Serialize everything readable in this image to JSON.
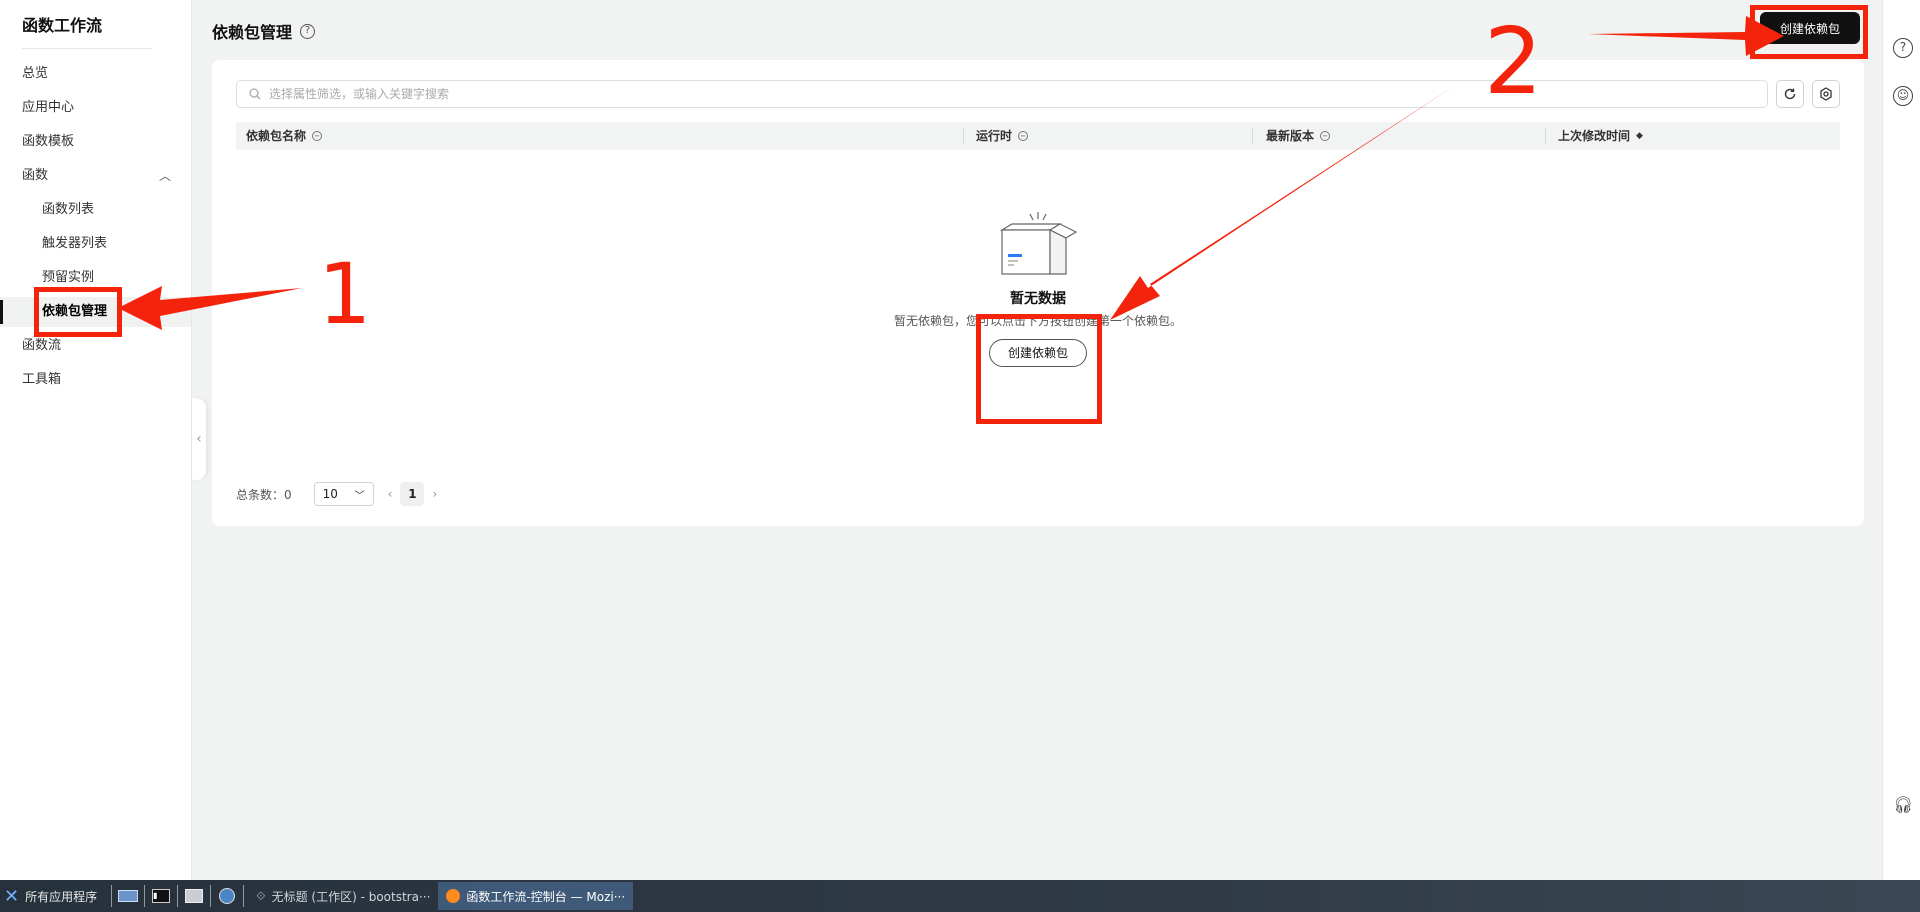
{
  "sidebar": {
    "title": "函数工作流",
    "items": [
      {
        "label": "总览"
      },
      {
        "label": "应用中心"
      },
      {
        "label": "函数模板"
      },
      {
        "label": "函数"
      },
      {
        "label": "函数列表"
      },
      {
        "label": "触发器列表"
      },
      {
        "label": "预留实例"
      },
      {
        "label": "依赖包管理"
      },
      {
        "label": "函数流"
      },
      {
        "label": "工具箱"
      }
    ]
  },
  "header": {
    "title": "依赖包管理",
    "create_label": "创建依赖包"
  },
  "search": {
    "placeholder": "选择属性筛选，或输入关键字搜索"
  },
  "table": {
    "columns": [
      "依赖包名称",
      "运行时",
      "最新版本",
      "上次修改时间"
    ]
  },
  "empty": {
    "title": "暂无数据",
    "desc": "暂无依赖包，您可以点击下方按钮创建第一个依赖包。",
    "button": "创建依赖包"
  },
  "pager": {
    "total_label": "总条数：0",
    "page_size": "10",
    "current_page": "1"
  },
  "annotations": {
    "num1": "1",
    "num2": "2",
    "color": "#f4230c"
  },
  "taskbar": {
    "start_label": "所有应用程序",
    "tasks": [
      {
        "label": "无标题 (工作区) - bootstra···"
      },
      {
        "label": "函数工作流-控制台 — Mozi···"
      }
    ]
  }
}
